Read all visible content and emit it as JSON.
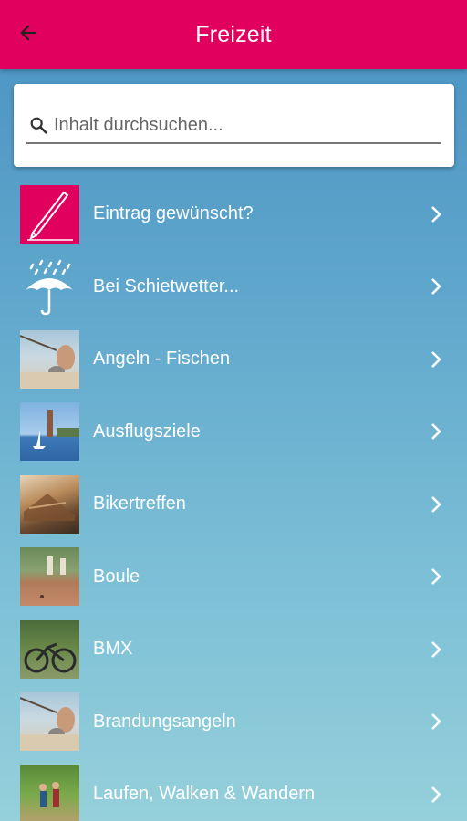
{
  "appbar": {
    "title": "Freizeit",
    "back_icon": "arrow-left-icon"
  },
  "search": {
    "placeholder": "Inhalt durchsuchen...",
    "value": "",
    "icon": "search-icon"
  },
  "colors": {
    "brand": "#e2005f",
    "text_on_brand": "#ffffff"
  },
  "items": [
    {
      "label": "Eintrag gewünscht?",
      "icon": "pencil-icon"
    },
    {
      "label": "Bei Schietwetter...",
      "icon": "umbrella-rain-icon"
    },
    {
      "label": "Angeln - Fischen",
      "icon": "fishing-photo"
    },
    {
      "label": "Ausflugsziele",
      "icon": "lighthouse-sailboat-photo"
    },
    {
      "label": "Bikertreffen",
      "icon": "shipwreck-photo"
    },
    {
      "label": "Boule",
      "icon": "boule-photo"
    },
    {
      "label": "BMX",
      "icon": "bmx-bike-photo"
    },
    {
      "label": "Brandungsangeln",
      "icon": "fishing-photo"
    },
    {
      "label": "Laufen, Walken & Wandern",
      "icon": "hikers-photo"
    }
  ]
}
